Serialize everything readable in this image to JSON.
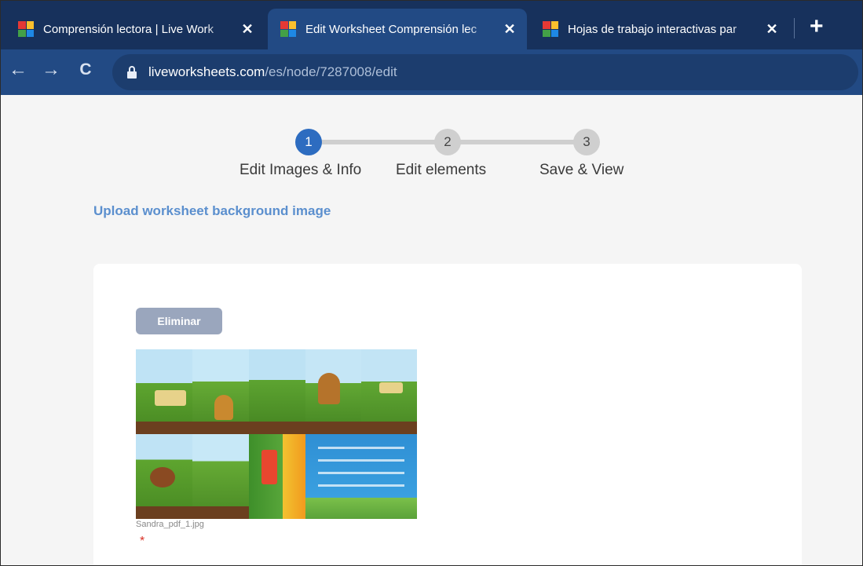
{
  "browser": {
    "tabs": [
      {
        "title": "Comprensión lectora | Live Work",
        "active": false
      },
      {
        "title": "Edit Worksheet Comprensión lec",
        "active": true
      },
      {
        "title": "Hojas de trabajo interactivas par",
        "active": false
      }
    ],
    "close_glyph": "✕",
    "new_tab_glyph": "+",
    "nav": {
      "back": "←",
      "forward": "→",
      "reload": "C"
    },
    "url_host": "liveworksheets.com",
    "url_path": "/es/node/7287008/edit",
    "favicon_colors": [
      "#e53935",
      "#fbc02d",
      "#43a047",
      "#1e88e5"
    ],
    "icons": [
      "lock-icon",
      "back-arrow-icon",
      "forward-arrow-icon",
      "reload-icon",
      "close-icon",
      "plus-icon"
    ]
  },
  "stepper": {
    "steps": [
      {
        "number": "1",
        "label": "Edit Images & Info",
        "active": true
      },
      {
        "number": "2",
        "label": "Edit elements",
        "active": false
      },
      {
        "number": "3",
        "label": "Save & View",
        "active": false
      }
    ]
  },
  "upload": {
    "heading": "Upload worksheet background image",
    "delete_label": "Eliminar",
    "filename": "Sandra_pdf_1.jpg",
    "required_mark": "*"
  },
  "colors": {
    "tabstrip": "#17315c",
    "toolbar": "#224a84",
    "step_active": "#2d6cc0",
    "step_inactive": "#cfcfcf",
    "heading_link": "#5b8fce",
    "delete_button": "#9aa6bd",
    "required": "#d93025"
  }
}
